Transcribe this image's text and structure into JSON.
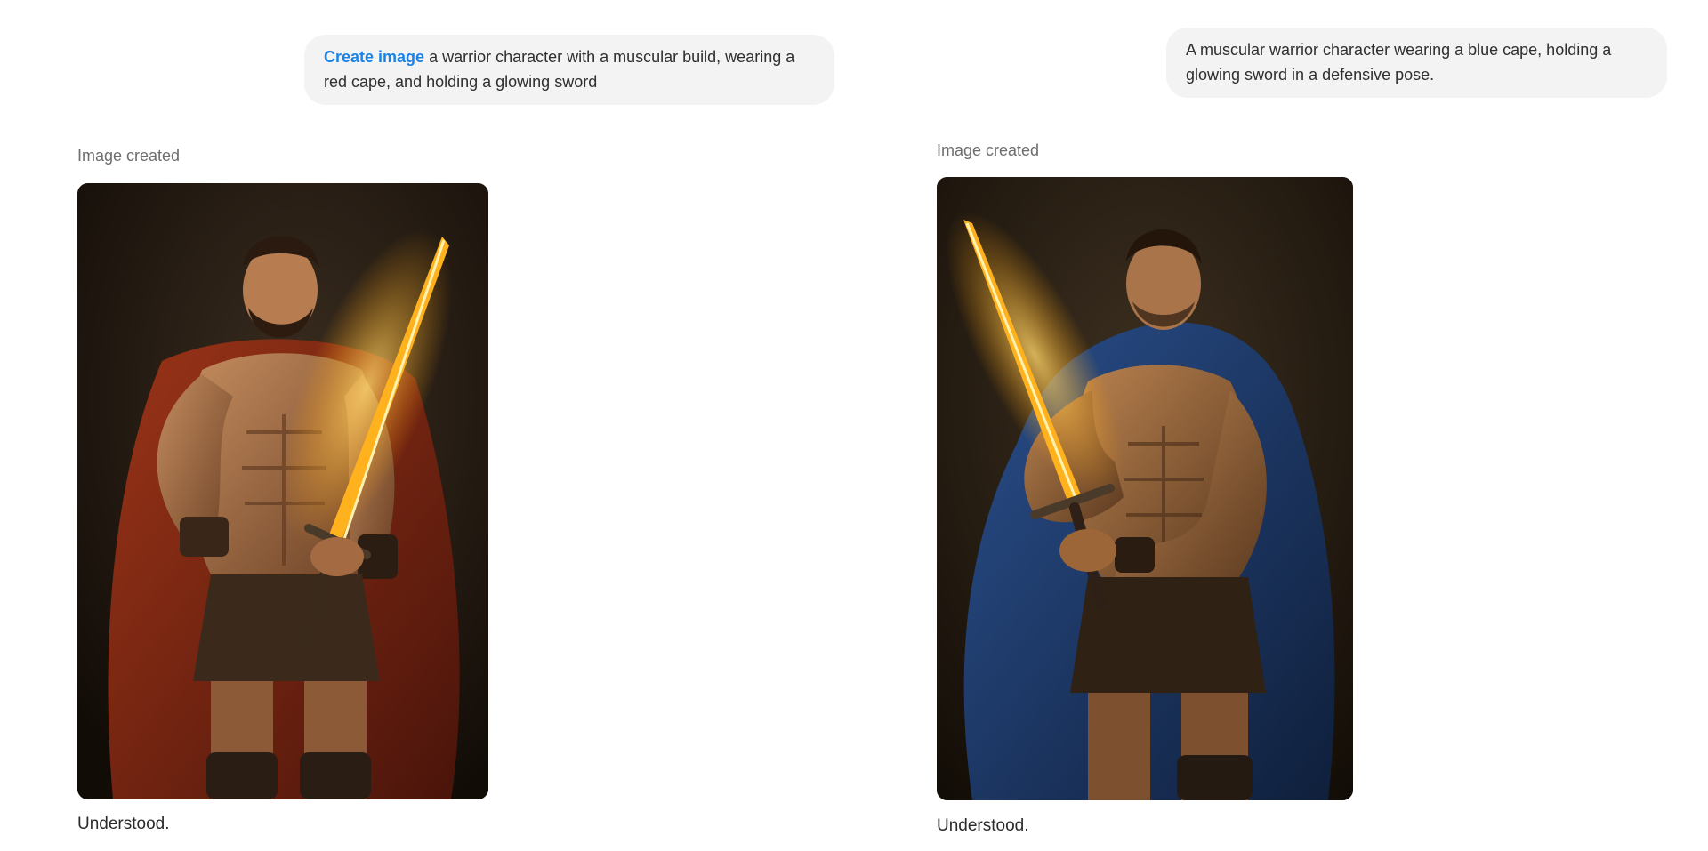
{
  "conversations": [
    {
      "user_prompt": {
        "command": "Create image",
        "text": " a warrior character with a muscular build, wearing a red cape, and holding a glowing sword"
      },
      "status": "Image created",
      "image": {
        "subject": "muscular bearded warrior in red cape holding glowing sword",
        "cape_color": "#8e2a14",
        "background_color": "#1c140d",
        "sword_glow_color": "#ffb21e"
      },
      "reply": "Understood."
    },
    {
      "user_prompt": {
        "command": "",
        "text": "A muscular warrior character wearing a blue cape, holding a glowing sword in a defensive pose."
      },
      "status": "Image created",
      "image": {
        "subject": "muscular warrior in blue cape holding glowing sword in defensive pose",
        "cape_color": "#1f3c6e",
        "background_color": "#1d160d",
        "sword_glow_color": "#ffb21e"
      },
      "reply": "Understood."
    }
  ]
}
